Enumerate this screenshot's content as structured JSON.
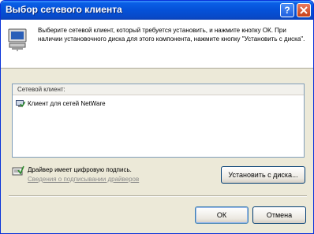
{
  "window": {
    "title": "Выбор сетевого клиента"
  },
  "titlebar": {
    "help_icon": "question-mark",
    "close_icon": "x"
  },
  "header": {
    "icon": "network-computer-icon",
    "instructions": "Выберите сетевой клиент, который требуется установить, и нажмите кнопку ОК. При наличии установочного диска для этого компонента, нажмите кнопку \"Установить с диска\"."
  },
  "list": {
    "header": "Сетевой клиент:",
    "items": [
      {
        "label": "Клиент для сетей NetWare",
        "icon": "network-client-icon"
      }
    ]
  },
  "signature": {
    "text": "Драйвер имеет цифровую подпись.",
    "link": "Сведения о подписывании драйверов"
  },
  "buttons": {
    "have_disk": "Установить с диска...",
    "ok": "ОК",
    "cancel": "Отмена"
  },
  "colors": {
    "titlebar": "#0551d8",
    "dialog_bg": "#ece9d8",
    "panel_bg": "#ffffff",
    "close_btn": "#c64019"
  }
}
